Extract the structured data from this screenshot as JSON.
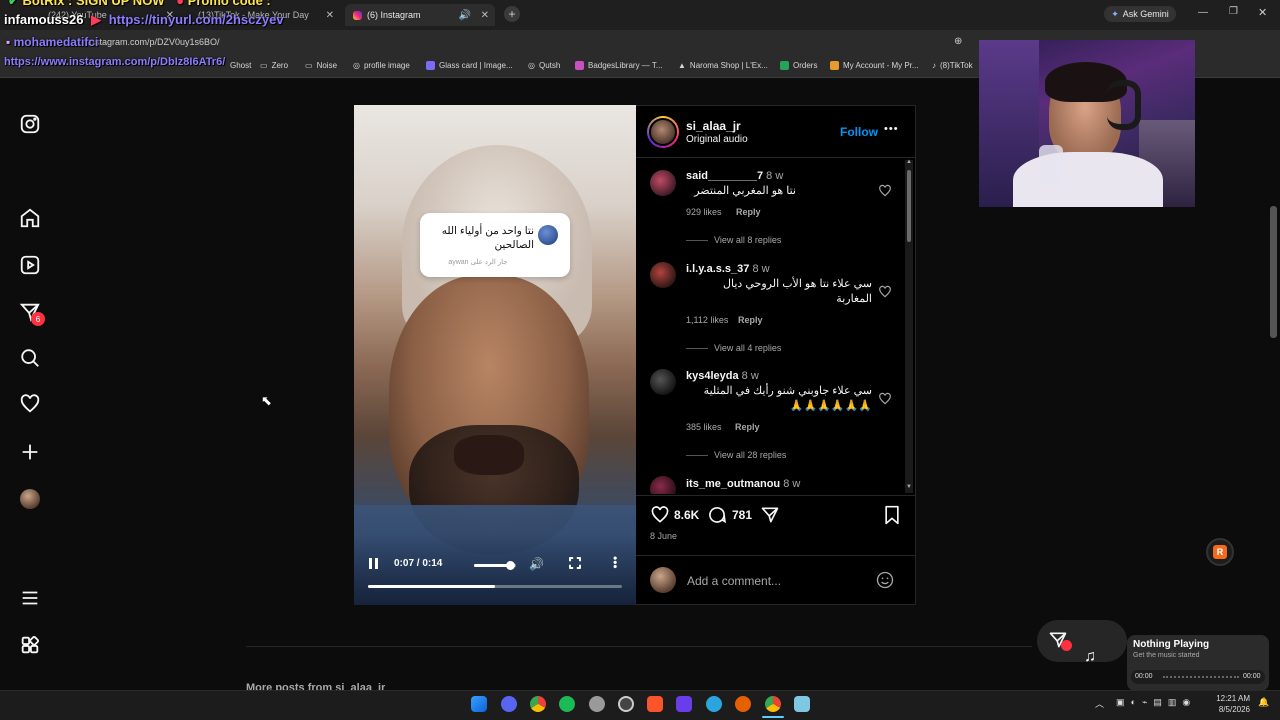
{
  "browser": {
    "tabs": [
      {
        "label": "(242) YouTube"
      },
      {
        "label": "(13)TikTok - Make Your Day"
      },
      {
        "label": "(6) Instagram"
      }
    ],
    "ask_gemini": "Ask Gemini",
    "url": "instagram.com/p/DZV0uy1s6BO/",
    "bookmarks": [
      "Ghost",
      "Zero",
      "Noise",
      "profile image",
      "Glass card | Image...",
      "Qutsh",
      "BadgesLibrary — T...",
      "Naroma Shop | L'Ex...",
      "Orders",
      "My Account - My Pr...",
      "(8)TikTok"
    ]
  },
  "overlay": {
    "line1a": "BotRix : SIGN UP NOW",
    "line1b": "Promo code :",
    "line2a": "infamouss26",
    "line2b": "https://tinyurl.com/2hsczyev",
    "line3": "mohamedatifci",
    "line4": "https://www.instagram.com/p/DbIz8I6ATr6/"
  },
  "nav": {
    "messages_badge": "6"
  },
  "post": {
    "username": "si_alaa_jr",
    "audio": "Original audio",
    "follow": "Follow",
    "more": "•••",
    "video_sticker": {
      "text_line1": "نتا واحد من أولياء الله",
      "text_line2": "الصالحين",
      "subtext": "جار الرد على aywan"
    },
    "video_time": "0:07 / 0:14",
    "video_progress": 0.5,
    "volume_level": 0.85,
    "comments": [
      {
        "user": "said________7",
        "time": "8 w",
        "text": "نتا هو المغربي المنتضر",
        "likes": "929 likes",
        "reply": "Reply",
        "view_replies": "View all 8 replies"
      },
      {
        "user": "i.l.y.a.s.s_37",
        "time": "8 w",
        "text_line1": "سي علاء نتا هو الأب الروحي ديال",
        "text_line2": "المغاربة",
        "likes": "1,112 likes",
        "reply": "Reply",
        "view_replies": "View all 4 replies"
      },
      {
        "user": "kys4leyda",
        "time": "8 w",
        "text_line1": "سي علاء جاوبني شنو رأيك في المثلية",
        "text_line2": "🙏🙏🙏🙏🙏🙏",
        "likes": "385 likes",
        "reply": "Reply",
        "view_replies": "View all 28 replies"
      },
      {
        "user": "its_me_outmanou",
        "time": "8 w"
      }
    ],
    "like_count": "8.6K",
    "comment_count": "781",
    "date": "8 June",
    "add_comment_placeholder": "Add a comment..."
  },
  "more_posts": "More posts from si_alaa_jr",
  "music_toast": {
    "title": "Nothing Playing",
    "subtitle": "Get the music started",
    "time_start": "00:00",
    "time_end": "00:00"
  },
  "taskbar": {
    "clock_time": "12:21 AM",
    "clock_date": "8/5/2026"
  },
  "colors": {
    "accent_blue": "#0095f6",
    "badge_red": "#ff3040",
    "overlay_purple": "#8a7dff",
    "overlay_yellow": "#ffe34d"
  }
}
